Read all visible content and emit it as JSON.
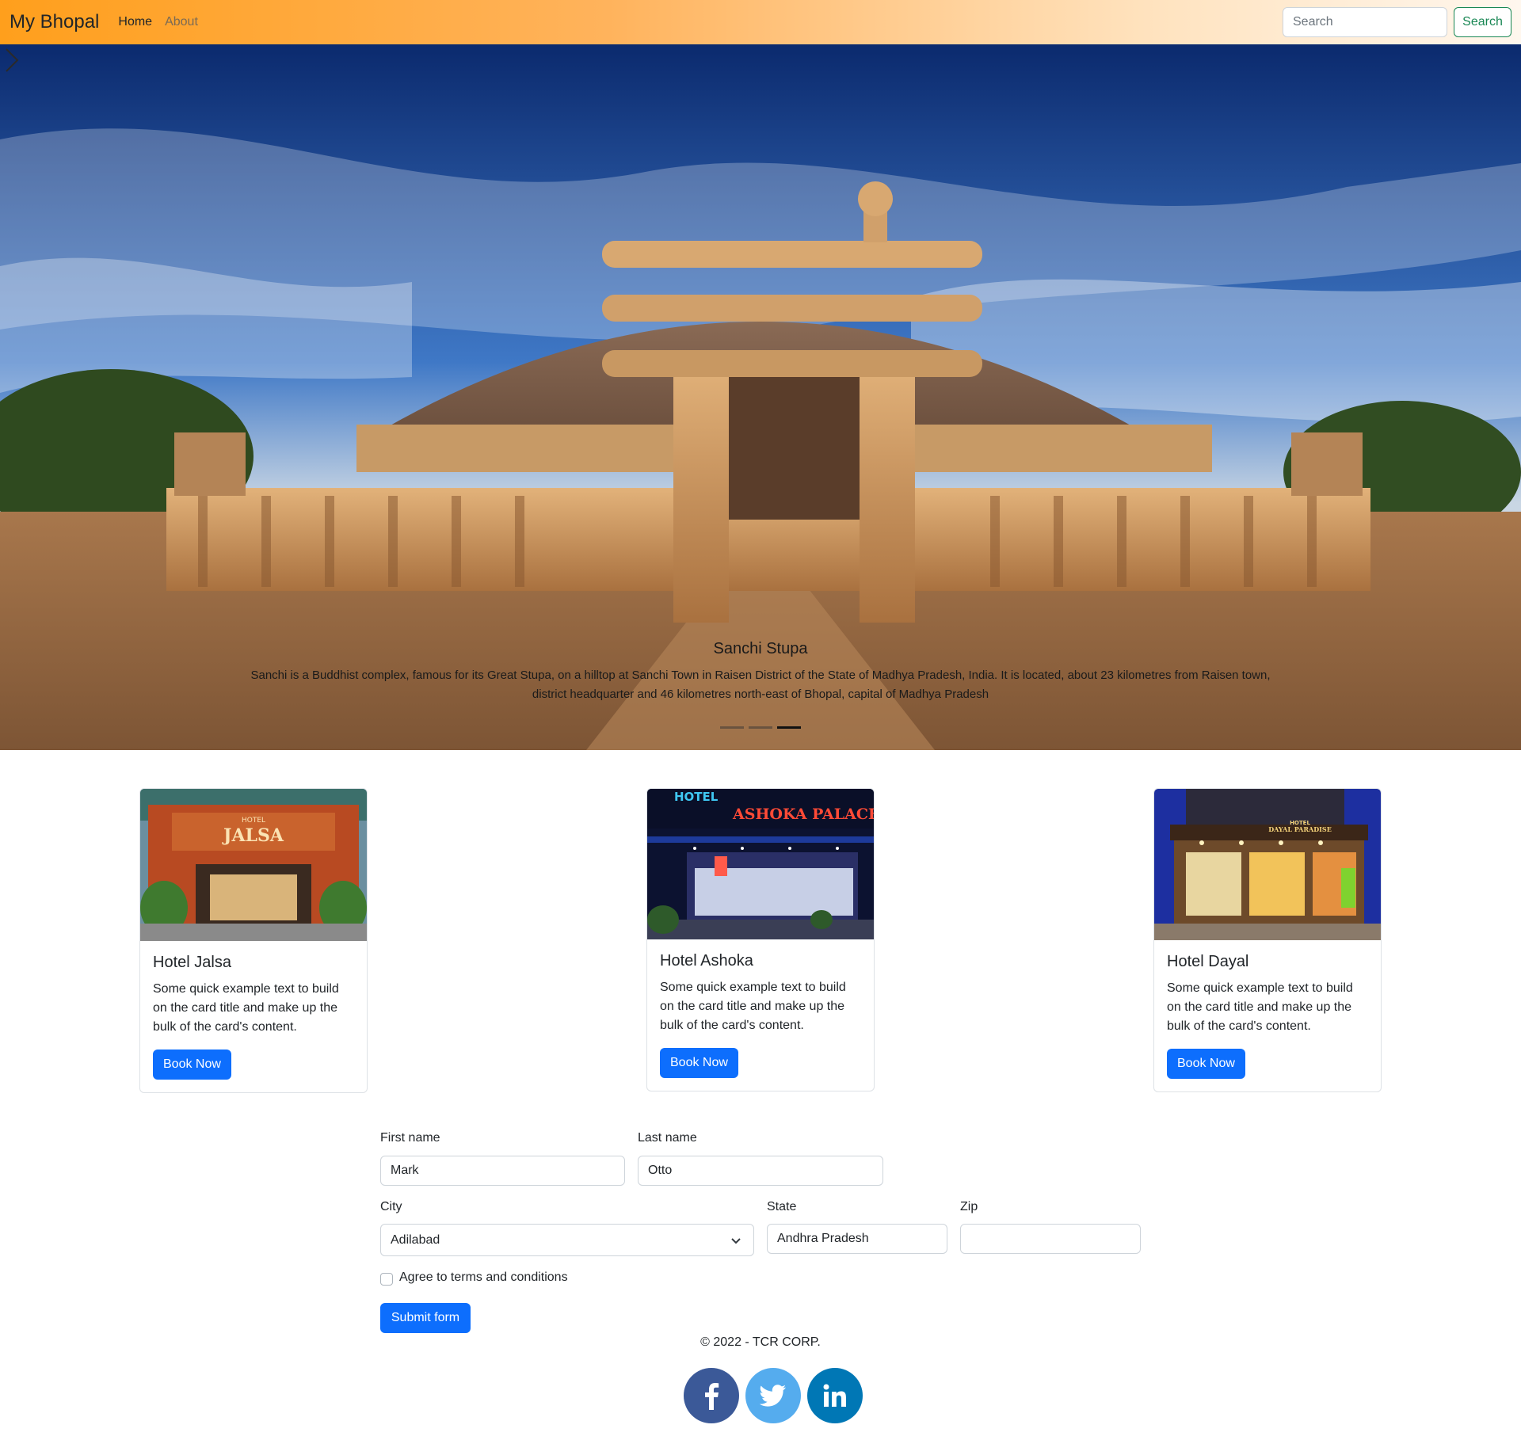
{
  "navbar": {
    "brand": "My Bhopal",
    "links": [
      {
        "label": "Home"
      },
      {
        "label": "About"
      }
    ],
    "search_placeholder": "Search",
    "search_button": "Search"
  },
  "carousel": {
    "slide_title": "Sanchi Stupa",
    "slide_text": "Sanchi is a Buddhist complex, famous for its Great Stupa, on a hilltop at Sanchi Town in Raisen District of the State of Madhya Pradesh, India. It is located, about 23 kilometres from Raisen town, district headquarter and 46 kilometres north-east of Bhopal, capital of Madhya Pradesh",
    "slide_count": 3,
    "active_slide": 3
  },
  "cards": [
    {
      "title": "Hotel Jalsa",
      "text": "Some quick example text to build on the card title and make up the bulk of the card's content.",
      "button": "Book Now",
      "sign_small": "HOTEL",
      "sign_big": "JALSA"
    },
    {
      "title": "Hotel Ashoka",
      "text": "Some quick example text to build on the card title and make up the bulk of the card's content.",
      "button": "Book Now",
      "sign_small": "HOTEL",
      "sign_big": "ASHOKA PALACE"
    },
    {
      "title": "Hotel Dayal",
      "text": "Some quick example text to build on the card title and make up the bulk of the card's content.",
      "button": "Book Now",
      "sign_small": "HOTEL",
      "sign_big": "DAYAL PARADISE"
    }
  ],
  "form": {
    "first_name_label": "First name",
    "first_name_value": "Mark",
    "last_name_label": "Last name",
    "last_name_value": "Otto",
    "city_label": "City",
    "city_value": "Adilabad",
    "state_label": "State",
    "state_value": "Andhra Pradesh",
    "zip_label": "Zip",
    "zip_value": "",
    "agree_label": "Agree to terms and conditions",
    "agree_checked": false,
    "submit_label": "Submit form"
  },
  "footer": {
    "copyright": "© 2022 - TCR CORP.",
    "social": [
      {
        "name": "facebook",
        "glyph": "f",
        "color": "#3b5998"
      },
      {
        "name": "twitter",
        "glyph": "bird",
        "color": "#55acee"
      },
      {
        "name": "linkedin",
        "glyph": "in",
        "color": "#0077b5"
      }
    ]
  },
  "colors": {
    "primary": "#0d6efd",
    "success": "#198754",
    "nav_orange": "#ff9f1c"
  }
}
